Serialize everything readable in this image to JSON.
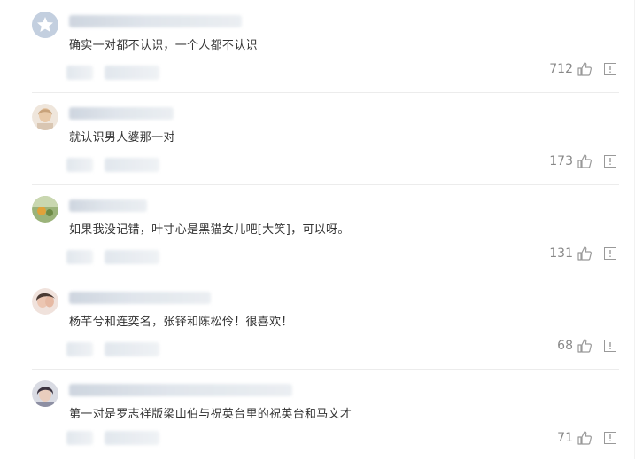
{
  "comments": [
    {
      "text": "确实一对都不认识，一个人都不认识",
      "likes": "712",
      "avatar": "default-star-avatar-icon"
    },
    {
      "text": "就认识男人婆那一对",
      "likes": "173",
      "avatar": "user-avatar-icon"
    },
    {
      "text": "如果我没记错，叶寸心是黑猫女儿吧[大笑]，可以呀。",
      "likes": "131",
      "avatar": "user-avatar-icon"
    },
    {
      "text": "杨芊兮和连奕名，张铎和陈松伶！很喜欢！",
      "likes": "68",
      "avatar": "user-avatar-icon"
    },
    {
      "text": "第一对是罗志祥版梁山伯与祝英台里的祝英台和马文才",
      "likes": "71",
      "avatar": "user-avatar-icon"
    }
  ],
  "icons": {
    "like": "thumbs-up-icon",
    "report": "report-icon"
  },
  "colors": {
    "text": "#333333",
    "meta": "#888888",
    "divider": "#ececec"
  }
}
